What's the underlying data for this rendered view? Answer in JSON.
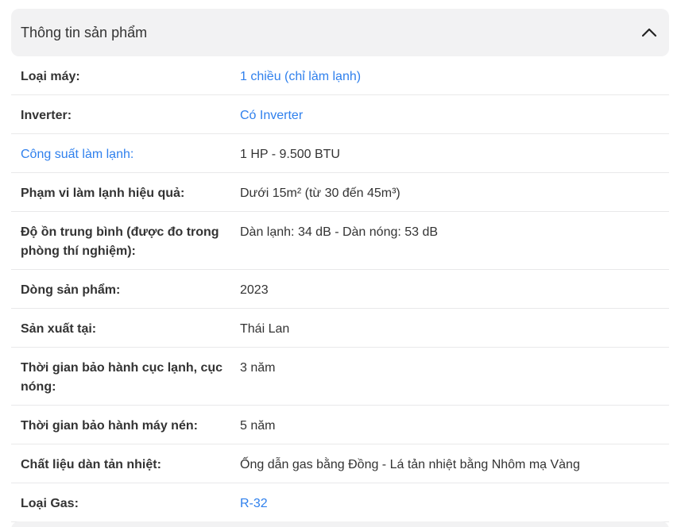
{
  "header": {
    "title": "Thông tin sản phẩm",
    "toggle_icon": "chevron-up-icon"
  },
  "colors": {
    "link": "#2f80ed",
    "header_bg": "#f2f2f3",
    "divider": "#e9e9ea"
  },
  "rows": [
    {
      "label": "Loại máy:",
      "value": "1 chiều (chỉ làm lạnh)",
      "label_link": false,
      "value_link": true,
      "lines": 1
    },
    {
      "label": "Inverter:",
      "value": "Có Inverter",
      "label_link": false,
      "value_link": true,
      "lines": 1
    },
    {
      "label": "Công suất làm lạnh:",
      "value": "1 HP - 9.500 BTU",
      "label_link": true,
      "value_link": false,
      "lines": 1
    },
    {
      "label": "Phạm vi làm lạnh hiệu quả:",
      "value": "Dưới 15m² (từ 30 đến 45m³)",
      "label_link": false,
      "value_link": false,
      "lines": 1
    },
    {
      "label": "Độ ồn trung bình (được đo trong phòng thí nghiệm):",
      "value": "Dàn lạnh: 34 dB - Dàn nóng: 53 dB",
      "label_link": false,
      "value_link": false,
      "lines": 2
    },
    {
      "label": "Dòng sản phẩm:",
      "value": "2023",
      "label_link": false,
      "value_link": false,
      "lines": 1
    },
    {
      "label": "Sản xuất tại:",
      "value": "Thái Lan",
      "label_link": false,
      "value_link": false,
      "lines": 1
    },
    {
      "label": "Thời gian bảo hành cục lạnh, cục nóng:",
      "value": "3 năm",
      "label_link": false,
      "value_link": false,
      "lines": 2
    },
    {
      "label": "Thời gian bảo hành máy nén:",
      "value": "5 năm",
      "label_link": false,
      "value_link": false,
      "lines": 1
    },
    {
      "label": "Chất liệu dàn tản nhiệt:",
      "value": "Ống dẫn gas bằng Đồng - Lá tản nhiệt bằng Nhôm mạ Vàng",
      "label_link": false,
      "value_link": false,
      "lines": 1
    },
    {
      "label": "Loại Gas:",
      "value": "R-32",
      "label_link": false,
      "value_link": true,
      "lines": 1
    }
  ]
}
